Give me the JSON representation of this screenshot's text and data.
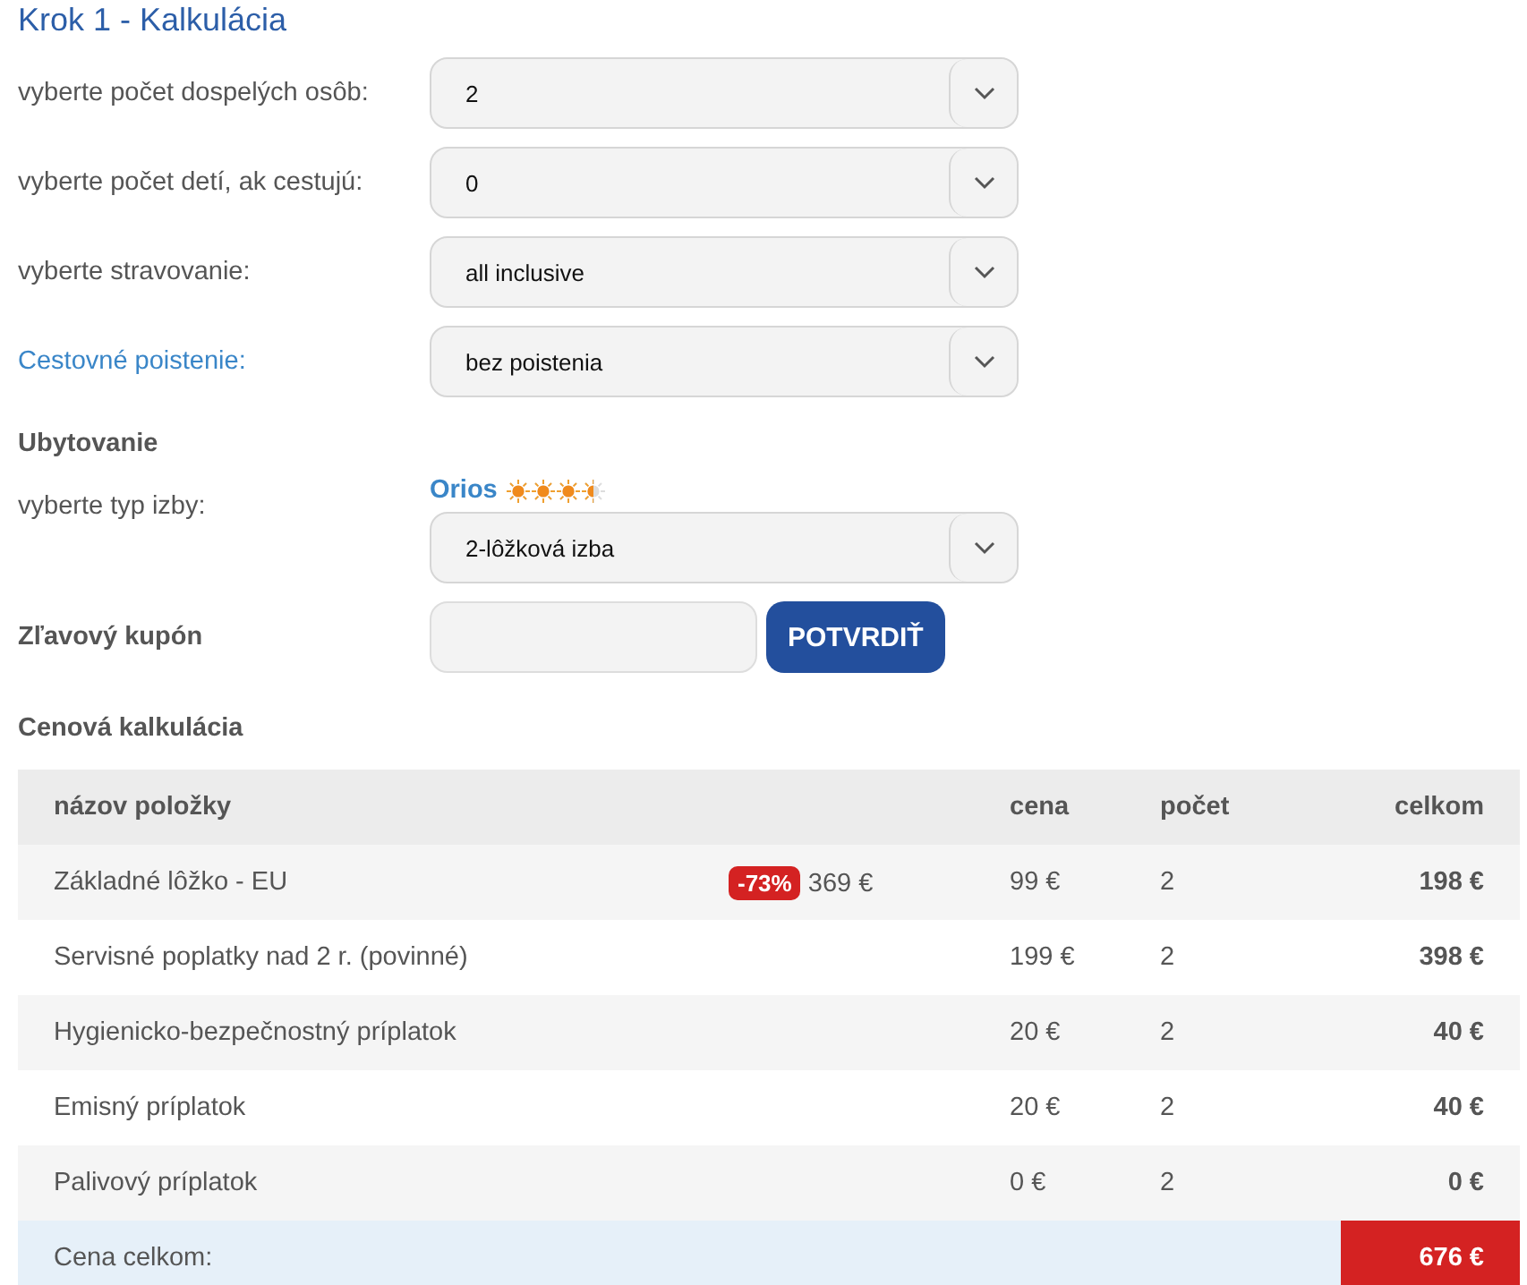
{
  "heading": "Krok 1 - Kalkulácia",
  "selects": [
    {
      "label": "vyberte počet dospelých osôb:",
      "kind": "plain",
      "value": "2"
    },
    {
      "label": "vyberte počet detí, ak cestujú:",
      "kind": "plain",
      "value": "0"
    },
    {
      "label": "vyberte stravovanie:",
      "kind": "plain",
      "value": "all inclusive"
    },
    {
      "label": "Cestovné poistenie:",
      "kind": "link",
      "value": "bez poistenia"
    }
  ],
  "accommodation": {
    "title": "Ubytovanie",
    "label": "vyberte typ izby:",
    "hotel": "Orios",
    "stars": 3.5,
    "value": "2-lôžková izba"
  },
  "coupon": {
    "label": "Zľavový kupón",
    "button": "POTVRDIŤ"
  },
  "calculation": {
    "title": "Cenová kalkulácia",
    "columns": [
      "názov položky",
      "cena",
      "počet",
      "celkom"
    ],
    "rows": [
      {
        "name": "Základné lôžko - EU",
        "discount": "-73%",
        "old_price": "369 €",
        "price": "99 €",
        "count": "2",
        "total": "198 €"
      },
      {
        "name": "Servisné poplatky nad 2 r. (povinné)",
        "price": "199 €",
        "count": "2",
        "total": "398 €"
      },
      {
        "name": "Hygienicko-bezpečnostný príplatok",
        "price": "20 €",
        "count": "2",
        "total": "40 €"
      },
      {
        "name": "Emisný príplatok",
        "price": "20 €",
        "count": "2",
        "total": "40 €"
      },
      {
        "name": "Palivový príplatok",
        "price": "0 €",
        "count": "2",
        "total": "0 €"
      }
    ],
    "total_label": "Cena celkom:",
    "total": "676 €"
  }
}
